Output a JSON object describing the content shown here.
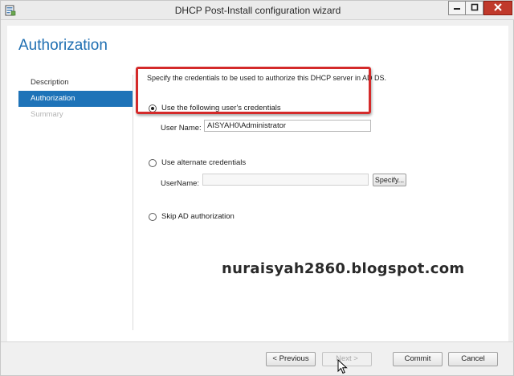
{
  "window": {
    "title": "DHCP Post-Install configuration wizard"
  },
  "page": {
    "title": "Authorization"
  },
  "nav": {
    "items": [
      {
        "label": "Description",
        "state": "normal"
      },
      {
        "label": "Authorization",
        "state": "active"
      },
      {
        "label": "Summary",
        "state": "disabled"
      }
    ]
  },
  "main": {
    "description": "Specify the credentials to be used to authorize this DHCP server in AD DS.",
    "option_current_user": {
      "label": "Use the following user's credentials",
      "selected": true,
      "username_label": "User Name:",
      "username_value": "AISYAH0\\Administrator"
    },
    "option_alternate": {
      "label": "Use alternate credentials",
      "selected": false,
      "username_label": "UserName:",
      "username_value": "",
      "specify_label": "Specify..."
    },
    "option_skip": {
      "label": "Skip AD authorization",
      "selected": false
    }
  },
  "watermark": {
    "text": "nuraisyah2860.blogspot.com"
  },
  "footer": {
    "previous_label": "< Previous",
    "next_label": "Next >",
    "commit_label": "Commit",
    "cancel_label": "Cancel"
  },
  "colors": {
    "accent": "#1e73b8",
    "title": "#1f6fb2",
    "highlight": "#d42a2a",
    "close_button": "#c0392b"
  },
  "icons": {
    "app": "server-wizard-icon",
    "minimize": "minimize-icon",
    "maximize": "maximize-icon",
    "close": "close-icon",
    "cursor": "mouse-pointer-icon"
  }
}
